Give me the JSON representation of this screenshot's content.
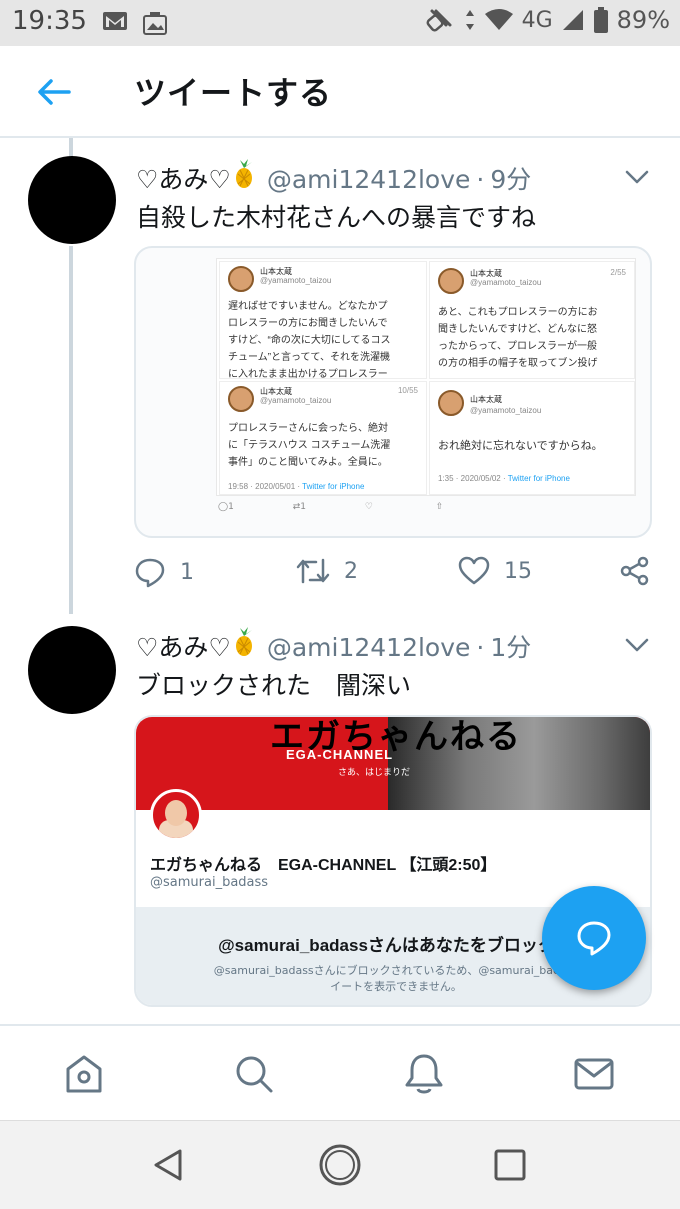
{
  "status_bar": {
    "time": "19:35",
    "network": "4G",
    "battery": "89%",
    "icons": [
      "gmail-icon",
      "photo-notification-icon",
      "nfc-icon",
      "data-arrows-icon",
      "wifi-icon",
      "signal-icon",
      "battery-icon"
    ]
  },
  "header": {
    "title": "ツイートする",
    "back_icon": "arrow-left-icon"
  },
  "tweets": [
    {
      "name": "♡あみ♡",
      "handle": "@ami12412love",
      "separator": "·",
      "time": "9分",
      "text": "自殺した木村花さんへの暴言ですね",
      "quoted_screenshots": [
        {
          "name": "山本太蔵",
          "handle": "@yamamoto_taizou",
          "count": "",
          "text": "遅ればせですいません。どなたかプ\nロレスラーの方にお聞きしたいんで\nすけど、“命の次に大切にしてるコス\nチューム”と言ってて、それを洗濯機\nに入れたまま出かけるプロレスラー"
        },
        {
          "name": "山本太蔵",
          "handle": "@yamamoto_taizou",
          "count": "2/55",
          "text": "あと、これもプロレスラーの方にお\n聞きしたいんですけど、どんなに怒\nったからって、プロレスラーが一般\nの方の相手の帽子を取ってブン投げ"
        },
        {
          "name": "山本太蔵",
          "handle": "@yamamoto_taizou",
          "count": "10/55",
          "text": "プロレスラーさんに会ったら、絶対\nに「テラスハウス コスチューム洗濯\n事件」のこと聞いてみよ。全員に。",
          "meta_time": "19:58 · 2020/05/01 · ",
          "meta_source": "Twitter for iPhone"
        },
        {
          "name": "山本太蔵",
          "handle": "@yamamoto_taizou",
          "count": "",
          "text": "おれ絶対に忘れないですからね。",
          "meta_time": "1:35 · 2020/05/02 · ",
          "meta_source": "Twitter for iPhone"
        }
      ],
      "quoted_inner_actions": {
        "reply": "1",
        "retweet": "1"
      },
      "actions": {
        "reply": "1",
        "retweet": "2",
        "like": "15"
      }
    },
    {
      "name": "♡あみ♡",
      "handle": "@ami12412love",
      "separator": "·",
      "time": "1分",
      "text": "ブロックされた　闇深い",
      "card": {
        "banner_logo": "エガちゃんねる",
        "banner_sub": "EGA-CHANNEL",
        "banner_sub2": "さあ、はじまりだ",
        "profile_name": "エガちゃんねる　EGA-CHANNEL 【江頭2:50】",
        "profile_handle": "@samurai_badass",
        "blocked_title": "@samurai_badassさんはあなたをブロックし",
        "blocked_desc": "@samurai_badassさんにブロックされているため、@samurai_badass\nイートを表示できません。"
      }
    }
  ],
  "colors": {
    "accent": "#1da1f2",
    "text": "#14171a",
    "secondary": "#657786",
    "border": "#e1e8ed",
    "banner_red": "#d6151b"
  },
  "tabbar": {
    "items": [
      "home-icon",
      "search-icon",
      "notifications-icon",
      "messages-icon"
    ]
  },
  "navbar": {
    "items": [
      "back-triangle-icon",
      "home-circle-icon",
      "recents-square-icon"
    ]
  },
  "fab": {
    "icon": "compose-reply-icon"
  }
}
